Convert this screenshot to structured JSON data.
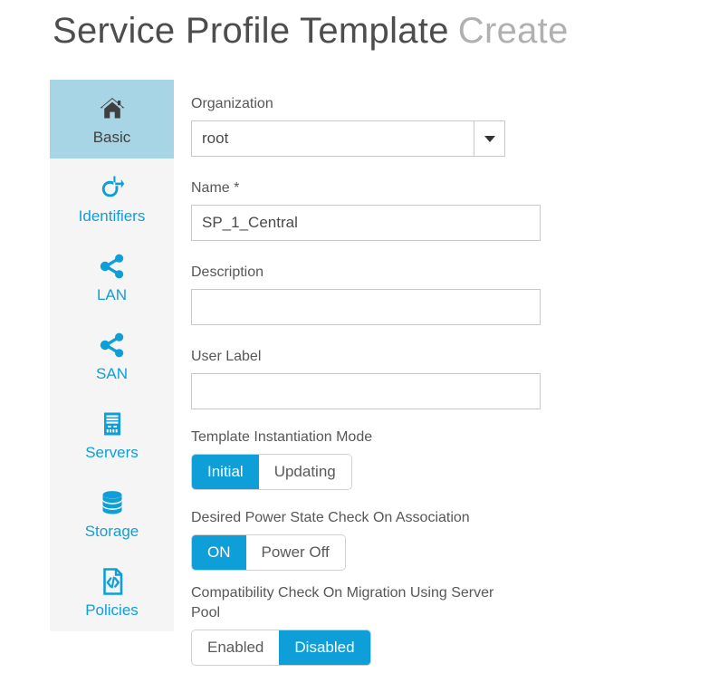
{
  "header": {
    "title_main": "Service Profile Template",
    "title_sub": "Create"
  },
  "colors": {
    "accent_blue": "#0f9fd8",
    "sidebar_selected_bg": "#a8d5e5",
    "sidebar_bg": "#f5f5f5",
    "title_main": "#4d4d4d",
    "title_sub": "#b0b0b0"
  },
  "sidebar": {
    "items": [
      {
        "label": "Basic",
        "icon": "home-icon",
        "selected": true
      },
      {
        "label": "Identifiers",
        "icon": "identifier-icon",
        "selected": false
      },
      {
        "label": "LAN",
        "icon": "network-share-icon",
        "selected": false
      },
      {
        "label": "SAN",
        "icon": "network-share-icon",
        "selected": false
      },
      {
        "label": "Servers",
        "icon": "server-rack-icon",
        "selected": false
      },
      {
        "label": "Storage",
        "icon": "database-stack-icon",
        "selected": false
      },
      {
        "label": "Policies",
        "icon": "code-document-icon",
        "selected": false
      }
    ]
  },
  "form": {
    "organization": {
      "label": "Organization",
      "value": "root",
      "placeholder": "",
      "dropdown_icon": "chevron-down-icon"
    },
    "name": {
      "label": "Name",
      "required_marker": "*",
      "value": "SP_1_Central",
      "placeholder": ""
    },
    "description": {
      "label": "Description",
      "value": "",
      "placeholder": ""
    },
    "user_label": {
      "label": "User Label",
      "value": "",
      "placeholder": ""
    },
    "template_instantiation_mode": {
      "label": "Template Instantiation Mode",
      "options": [
        "Initial",
        "Updating"
      ],
      "selected": "Initial"
    },
    "desired_power_state": {
      "label": "Desired Power State Check On Association",
      "options": [
        "ON",
        "Power Off"
      ],
      "selected": "ON"
    },
    "compatibility_check": {
      "label": "Compatibility Check On Migration Using Server Pool",
      "options": [
        "Enabled",
        "Disabled"
      ],
      "selected": "Disabled"
    }
  }
}
